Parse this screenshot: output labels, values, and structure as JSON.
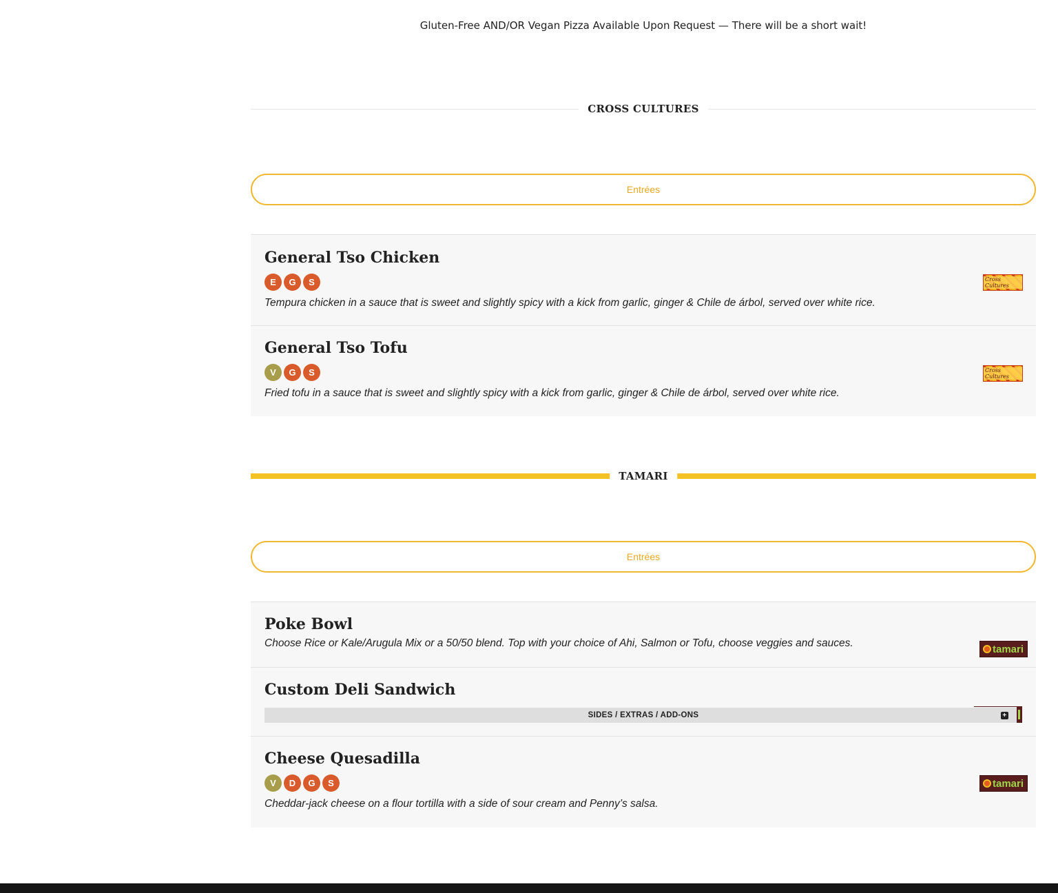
{
  "notice": "Gluten-Free AND/OR Vegan Pizza Available Upon Request — There will be a short wait!",
  "sections": [
    {
      "title": "CROSS CULTURES",
      "category": "Entrées",
      "items": [
        {
          "name": "General Tso Chicken",
          "badges": [
            "E",
            "G",
            "S"
          ],
          "description": "Tempura chicken in a sauce that is sweet and slightly spicy with a kick from garlic, ginger & Chile de árbol, served over white rice.",
          "logo": "Cross Cultures"
        },
        {
          "name": "General Tso Tofu",
          "badges": [
            "V",
            "G",
            "S"
          ],
          "description": "Fried tofu in a sauce that is sweet and slightly spicy with a kick from garlic, ginger & Chile de árbol, served over white rice.",
          "logo": "Cross Cultures"
        }
      ]
    },
    {
      "title": "TAMARI",
      "category": "Entrées",
      "items": [
        {
          "name": "Poke Bowl",
          "description": "Choose Rice or Kale/Arugula Mix or a 50/50 blend. Top with your choice of Ahi, Salmon or Tofu, choose veggies and sauces.",
          "logo": "tamari"
        },
        {
          "name": "Custom Deli Sandwich",
          "addons_label": "SIDES / EXTRAS / ADD-ONS",
          "addons_icon": "plus-square-icon"
        },
        {
          "name": "Cheese Quesadilla",
          "badges": [
            "V",
            "D",
            "G",
            "S"
          ],
          "description": "Cheddar-jack cheese on a flour tortilla with a side of sour cream and Penny’s salsa.",
          "logo": "tamari"
        }
      ]
    }
  ],
  "colors": {
    "accent_yellow": "#f5c226",
    "pill_text": "#e8a820",
    "badge_orange": "#d95a2b",
    "badge_olive": "#a89d4a"
  }
}
